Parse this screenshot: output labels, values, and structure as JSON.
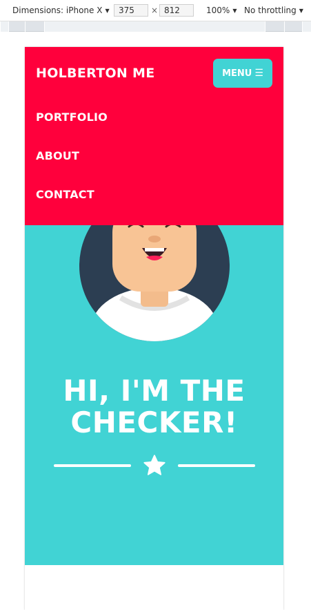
{
  "devtools": {
    "device_label": "Dimensions: iPhone X",
    "width_value": "375",
    "times_sign": "×",
    "height_value": "812",
    "zoom_label": "100%",
    "throttle_label": "No throttling"
  },
  "navbar": {
    "brand": "HOLBERTON ME",
    "menu_label": "MENU",
    "menu_icon": "☰",
    "links": [
      "PORTFOLIO",
      "ABOUT",
      "CONTACT"
    ]
  },
  "hero": {
    "title_line1": "HI, I'M THE",
    "title_line2": "CHECKER!",
    "divider_icon": "star-icon"
  },
  "colors": {
    "navbar_bg": "#ff003c",
    "hero_bg": "#41d3d4",
    "avatar_bg": "#2c3e52",
    "text": "#ffffff"
  }
}
